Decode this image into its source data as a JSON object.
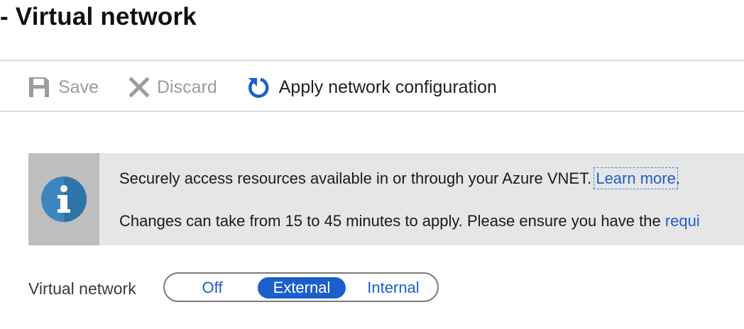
{
  "page": {
    "title": "- Virtual network"
  },
  "toolbar": {
    "save_label": "Save",
    "discard_label": "Discard",
    "apply_label": "Apply network configuration",
    "icons": {
      "save": "save-disk-icon",
      "discard": "x-icon",
      "apply": "refresh-icon"
    }
  },
  "banner": {
    "icon": "info-icon",
    "line1_text": "Securely access resources available in or through your Azure VNET. ",
    "line1_link": "Learn more",
    "line1_suffix": ".",
    "line2_text": "Changes can take from 15 to 45 minutes to apply. Please ensure you have the ",
    "line2_link": "requi"
  },
  "virtual_network": {
    "label": "Virtual network",
    "options": [
      "Off",
      "External",
      "Internal"
    ],
    "selected": "External"
  },
  "colors": {
    "accent": "#1b5fcc",
    "banner_bg": "#e6e6e6",
    "banner_side": "#bebebe",
    "disabled_text": "#9c9c9c"
  }
}
